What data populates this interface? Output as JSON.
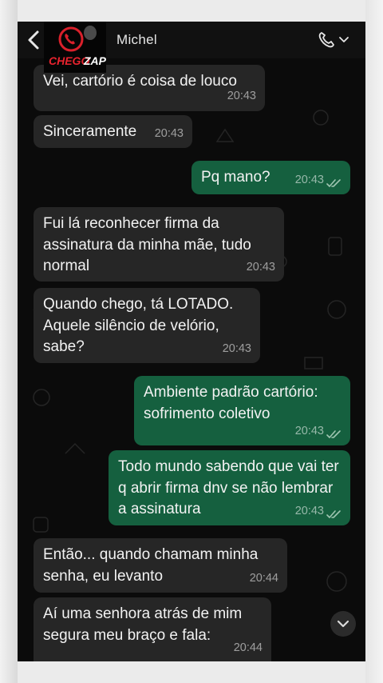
{
  "header": {
    "contact_name": "Michel",
    "logo_text_1": "CHEGO",
    "logo_text_2": "ZAP"
  },
  "messages": [
    {
      "dir": "in",
      "text": "Vei, cartório é coisa de louco",
      "time": "20:43"
    },
    {
      "dir": "in",
      "text": "Sinceramente",
      "time": "20:43"
    },
    {
      "dir": "out",
      "text": "Pq mano?",
      "time": "20:43",
      "status": "read"
    },
    {
      "dir": "in",
      "text": "Fui lá reconhecer firma da assinatura da minha mãe, tudo normal",
      "time": "20:43"
    },
    {
      "dir": "in",
      "text": "Quando chego, tá LOTADO. Aquele silêncio de velório, sabe?",
      "time": "20:43"
    },
    {
      "dir": "out",
      "text": "Ambiente padrão cartório: sofrimento coletivo",
      "time": "20:43",
      "status": "read"
    },
    {
      "dir": "out",
      "text": "Todo mundo sabendo que vai ter q abrir firma dnv se não lembrar a assinatura",
      "time": "20:43",
      "status": "read"
    },
    {
      "dir": "in",
      "text": "Então... quando chamam minha senha, eu levanto",
      "time": "20:44"
    },
    {
      "dir": "in",
      "text": "Aí uma senhora atrás de mim segura meu braço e fala:",
      "time": "20:44"
    }
  ],
  "colors": {
    "incoming_bubble": "#262626",
    "outgoing_bubble": "#15603f",
    "read_ticks": "#9fc5b1",
    "background": "#0b0b0b"
  },
  "icons": [
    "back-arrow-icon",
    "phone-icon",
    "chevron-down-icon",
    "double-check-icon",
    "scroll-down-icon"
  ]
}
